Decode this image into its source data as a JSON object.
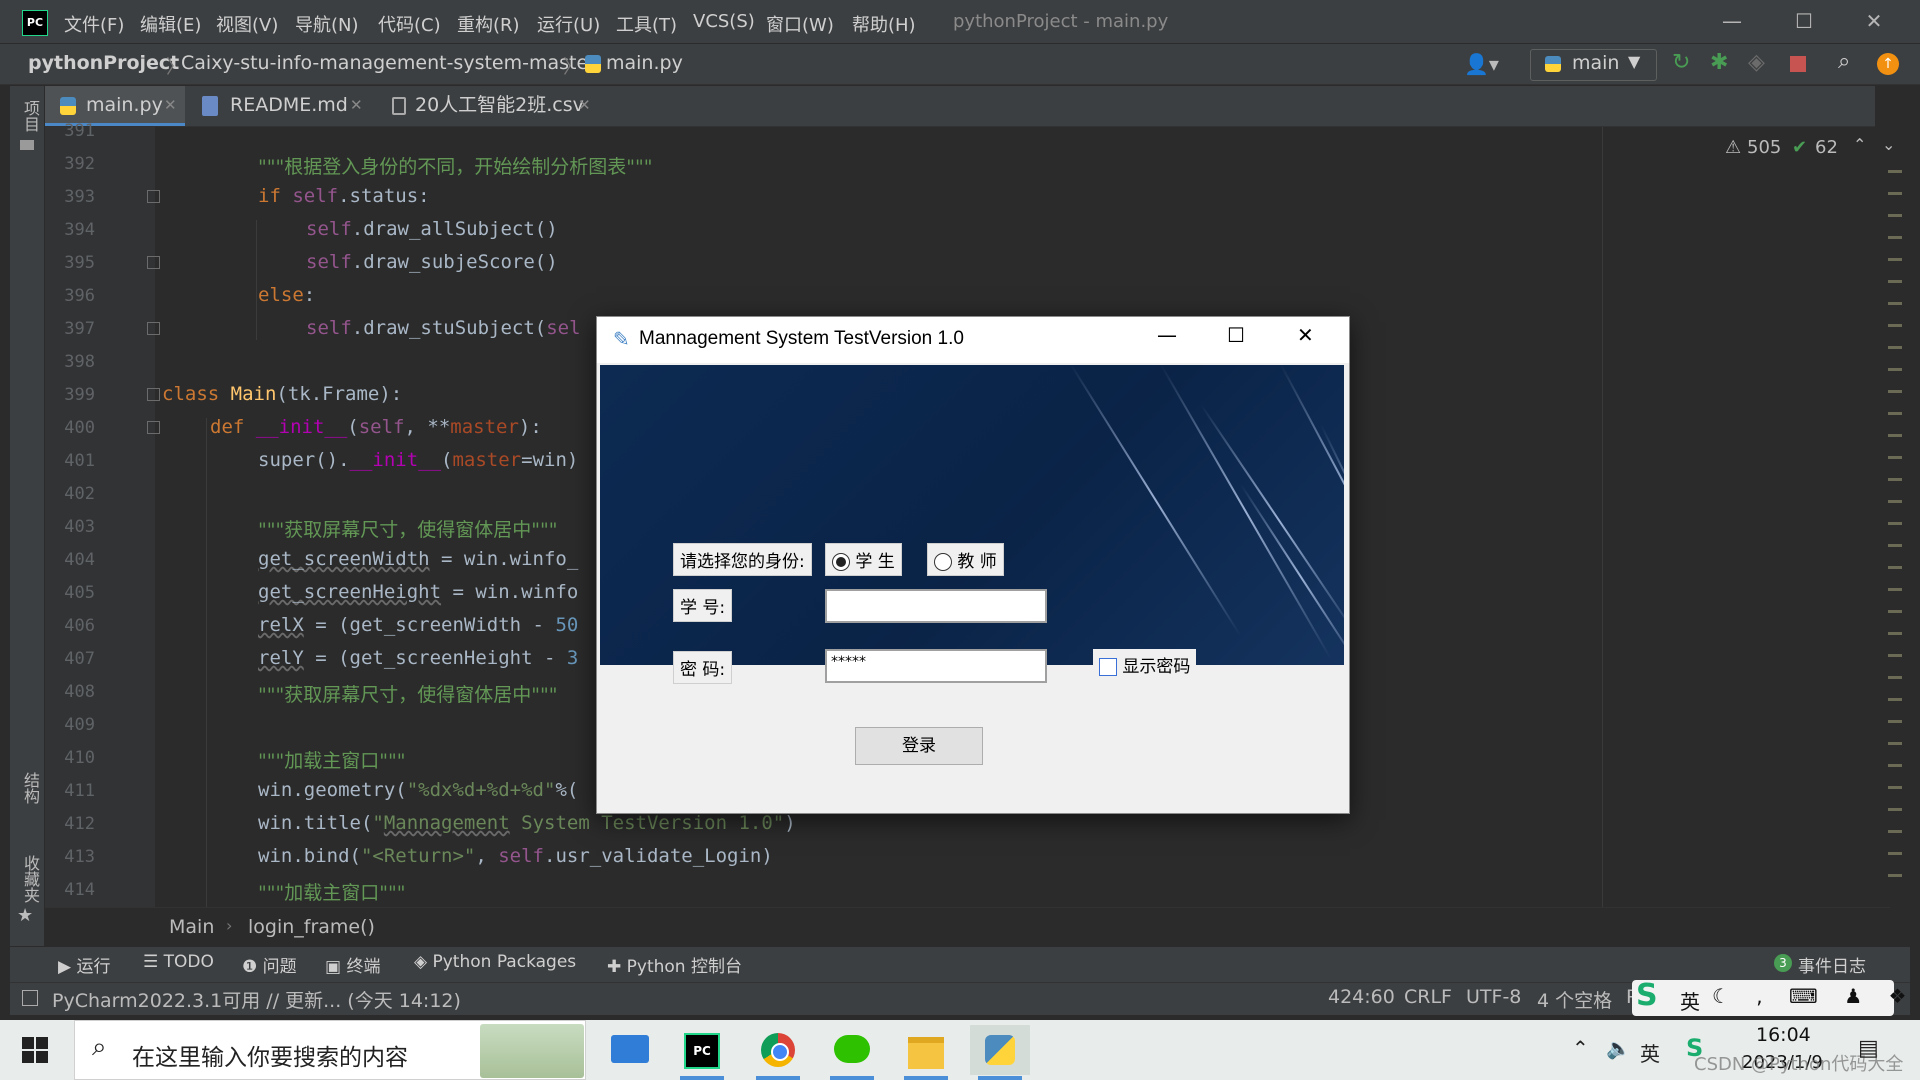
{
  "app": {
    "title": "pythonProject - main.py",
    "menu": [
      "文件(F)",
      "编辑(E)",
      "视图(V)",
      "导航(N)",
      "代码(C)",
      "重构(R)",
      "运行(U)",
      "工具(T)",
      "VCS(S)",
      "窗口(W)",
      "帮助(H)"
    ]
  },
  "navbar": {
    "project": "pythonProject",
    "folder": "Caixy-stu-info-management-system-master",
    "file": "main.py",
    "run_config": "main"
  },
  "tabs": [
    {
      "label": "main.py",
      "active": true
    },
    {
      "label": "README.md",
      "active": false
    },
    {
      "label": "20人工智能2班.csv",
      "active": false
    }
  ],
  "left_strip": {
    "project": "项目",
    "structure": "结构",
    "favorites": "收藏夹"
  },
  "inspections": {
    "warnings": "505",
    "ok": "62"
  },
  "code": {
    "lines": [
      {
        "n": "391"
      },
      {
        "n": "392"
      },
      {
        "n": "393"
      },
      {
        "n": "394"
      },
      {
        "n": "395"
      },
      {
        "n": "396"
      },
      {
        "n": "397"
      },
      {
        "n": "398"
      },
      {
        "n": "399"
      },
      {
        "n": "400"
      },
      {
        "n": "401"
      },
      {
        "n": "402"
      },
      {
        "n": "403"
      },
      {
        "n": "404"
      },
      {
        "n": "405"
      },
      {
        "n": "406"
      },
      {
        "n": "407"
      },
      {
        "n": "408"
      },
      {
        "n": "409"
      },
      {
        "n": "410"
      },
      {
        "n": "411"
      },
      {
        "n": "412"
      },
      {
        "n": "413"
      },
      {
        "n": "414"
      }
    ],
    "t392": "\"\"\"根据登入身份的不同，开始绘制分析图表\"\"\"",
    "t393_kw": "if ",
    "t393_self": "self",
    "t393_rest": ".status:",
    "t394_self": "self",
    "t394_rest": ".draw_allSubject()",
    "t395_self": "self",
    "t395_rest": ".draw_subjeScore()",
    "t396_kw": "else",
    "t396_rest": ":",
    "t397_self": "self",
    "t397_rest": ".draw_stuSubject(",
    "t397_tail": "sel",
    "t399_kw": "class ",
    "t399_cls": "Main",
    "t399_rest": "(tk.Frame):",
    "t400_kw": "def ",
    "t400_fn": "__init__",
    "t400_a": "(",
    "t400_self": "self",
    "t400_b": ", **",
    "t400_p": "master",
    "t400_c": "):",
    "t401_a": "super().",
    "t401_fn": "__init__",
    "t401_b": "(",
    "t401_p": "master",
    "t401_c": "=win)",
    "t403": "\"\"\"获取屏幕尺寸，使得窗体居中\"\"\"",
    "t404_var": "get_screenWidth",
    "t404_rest": " = win.winfo_",
    "t405_var": "get_screenHeight",
    "t405_rest": " = win.winfo",
    "t406_var": "relX",
    "t406_rest": " = (get_screenWidth - ",
    "t406_num": "50",
    "t407_var": "relY",
    "t407_rest": " = (get_screenHeight - ",
    "t407_num": "3",
    "t408": "\"\"\"获取屏幕尺寸，使得窗体居中\"\"\"",
    "t410": "\"\"\"加载主窗口\"\"\"",
    "t411_a": "win.geometry(",
    "t411_str": "\"%dx%d+%d+%d\"",
    "t411_b": "%(",
    "t412_a": "win.title(",
    "t412_q1": "\"",
    "t412_u": "Mannagement",
    "t412_str": " System TestVersion 1.0\"",
    "t412_b": ")",
    "t413_a": "win.bind(",
    "t413_str": "\"<Return>\"",
    "t413_b": ", ",
    "t413_self": "self",
    "t413_c": ".usr_validate_Login)",
    "t414": "\"\"\"加载主窗口\"\"\""
  },
  "editor_breadcrumb": {
    "cls": "Main",
    "method": "login_frame()"
  },
  "toolwindows": {
    "run": "运行",
    "todo": "TODO",
    "problems": "问题",
    "terminal": "终端",
    "packages": "Python Packages",
    "console": "Python 控制台",
    "event_count": "3",
    "event_log": "事件日志"
  },
  "status": {
    "update": "PyCharm2022.3.1可用 // 更新... (今天 14:12)",
    "position": "424:60",
    "line_sep": "CRLF",
    "encoding": "UTF-8",
    "indent": "4 个空格",
    "interpreter": "P"
  },
  "ime": {
    "lang": "英"
  },
  "taskbar": {
    "search_placeholder": "在这里输入你要搜索的内容",
    "ime_tray": "英",
    "time": "16:04",
    "date": "2023/1/9",
    "watermark": "CSDN @Python代码大全"
  },
  "dialog": {
    "title": "Mannagement System TestVersion 1.0",
    "identity_label": "请选择您的身份:",
    "radio_student": "学 生",
    "radio_teacher": "教 师",
    "selected": "student",
    "id_label": "学 号:",
    "id_value": "",
    "pwd_label": "密 码:",
    "pwd_value": "*****",
    "show_pwd": "显示密码",
    "login_button": "登录"
  },
  "colors": {
    "accent": "#4a88c7",
    "run_green": "#499c54",
    "stop_red": "#c75450",
    "update_orange": "#f29111"
  }
}
